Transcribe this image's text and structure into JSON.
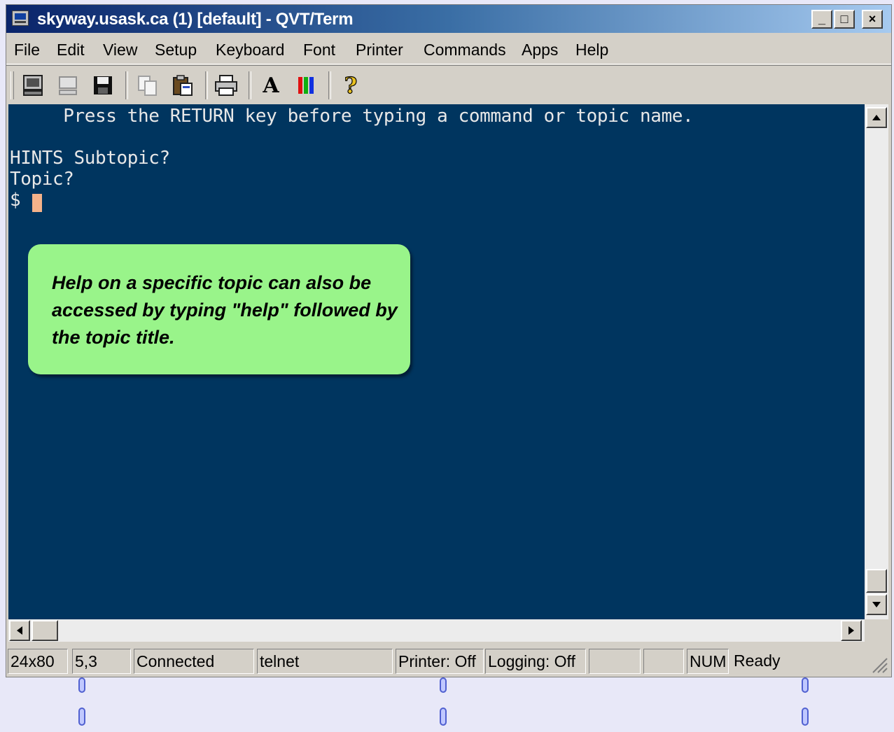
{
  "window": {
    "title": "skyway.usask.ca (1) [default] - QVT/Term",
    "controls": {
      "minimize": "_",
      "maximize": "□",
      "close": "×"
    }
  },
  "menu": {
    "items": [
      "File",
      "Edit",
      "View",
      "Setup",
      "Keyboard",
      "Font",
      "Printer",
      "Commands",
      "Apps",
      "Help"
    ]
  },
  "toolbar": {
    "icons": [
      "terminal-icon",
      "terminal-disabled-icon",
      "save-icon",
      "copy-icon",
      "paste-icon",
      "print-icon",
      "font-icon",
      "colors-icon",
      "help-icon"
    ],
    "font_glyph": "A",
    "help_glyph": "?"
  },
  "terminal": {
    "lines": [
      "     Press the RETURN key before typing a command or topic name.",
      "",
      "HINTS Subtopic?",
      "Topic?",
      "$ "
    ],
    "background": "#00355f",
    "foreground": "#e8e8e8",
    "cursor_color": "#f4b28a"
  },
  "callout": {
    "text": "Help on a specific topic can also be accessed by typing \"help\" followed by the topic title.",
    "color": "#99f48a"
  },
  "status": {
    "size": "24x80",
    "position": "5,3",
    "connection": "Connected",
    "protocol": "telnet",
    "printer": "Printer: Off",
    "logging": "Logging: Off",
    "blank1": "",
    "blank2": "",
    "num": "NUM",
    "ready": "Ready"
  }
}
